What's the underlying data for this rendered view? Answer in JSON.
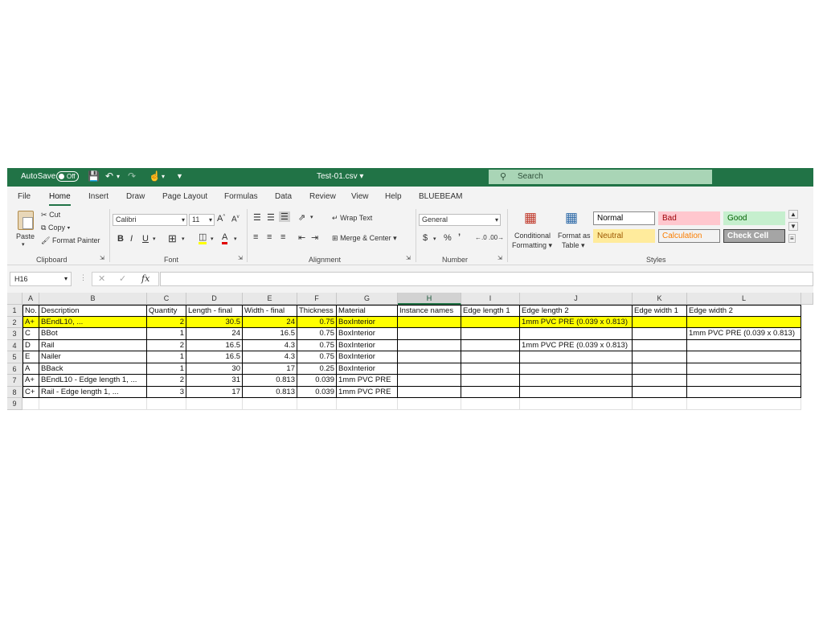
{
  "titlebar": {
    "autosave_label": "AutoSave",
    "autosave_state": "Off",
    "file_title": "Test-01.csv",
    "search_placeholder": "Search",
    "bg_color": "#217346"
  },
  "menu": [
    "File",
    "Home",
    "Insert",
    "Draw",
    "Page Layout",
    "Formulas",
    "Data",
    "Review",
    "View",
    "Help",
    "BLUEBEAM"
  ],
  "ribbon": {
    "clipboard": {
      "paste": "Paste",
      "cut": "Cut",
      "copy": "Copy",
      "format_painter": "Format Painter",
      "label": "Clipboard"
    },
    "font": {
      "name": "Calibri",
      "size": "11",
      "label": "Font"
    },
    "alignment": {
      "wrap": "Wrap Text",
      "merge": "Merge & Center",
      "label": "Alignment"
    },
    "number": {
      "format": "General",
      "label": "Number"
    },
    "styles_group": {
      "conditional": [
        "Conditional",
        "Formatting"
      ],
      "format_table": [
        "Format as",
        "Table"
      ],
      "label": "Styles"
    },
    "styles": [
      {
        "label": "Normal",
        "bg": "#ffffff",
        "color": "#000000",
        "border": "#8a8a8a"
      },
      {
        "label": "Bad",
        "bg": "#ffc7ce",
        "color": "#9c0006",
        "border": "#ffc7ce"
      },
      {
        "label": "Good",
        "bg": "#c6efce",
        "color": "#006100",
        "border": "#c6efce"
      },
      {
        "label": "Neutral",
        "bg": "#ffeb9c",
        "color": "#9c5700",
        "border": "#ffeb9c"
      },
      {
        "label": "Calculation",
        "bg": "#f2f2f2",
        "color": "#fa7d00",
        "border": "#7f7f7f"
      },
      {
        "label": "Check Cell",
        "bg": "#a5a5a5",
        "color": "#ffffff",
        "border": "#3f3f3f"
      }
    ]
  },
  "namebox": "H16",
  "sheet": {
    "columns": [
      "A",
      "B",
      "C",
      "D",
      "E",
      "F",
      "G",
      "H",
      "I",
      "J",
      "K",
      "L"
    ],
    "selected_column": "H",
    "row_numbers": [
      "1",
      "2",
      "3",
      "4",
      "5",
      "6",
      "7",
      "8",
      "9"
    ],
    "highlight_color": "#ffff00",
    "rows": [
      [
        "No.",
        "Description",
        "Quantity",
        "Length - final",
        "Width - final",
        "Thickness",
        "Material",
        "Instance names",
        "Edge length 1",
        "Edge length 2",
        "Edge width 1",
        "Edge width 2"
      ],
      [
        "A+",
        "BEndL10, ...",
        "2",
        "30.5",
        "24",
        "0.75",
        "BoxInterior",
        "",
        "",
        "1mm PVC PRE (0.039 x 0.813)",
        "",
        ""
      ],
      [
        "C",
        "BBot",
        "1",
        "24",
        "16.5",
        "0.75",
        "BoxInterior",
        "",
        "",
        "",
        "",
        "1mm PVC PRE (0.039 x 0.813)"
      ],
      [
        "D",
        "Rail",
        "2",
        "16.5",
        "4.3",
        "0.75",
        "BoxInterior",
        "",
        "",
        "1mm PVC PRE (0.039 x 0.813)",
        "",
        ""
      ],
      [
        "E",
        "Nailer",
        "1",
        "16.5",
        "4.3",
        "0.75",
        "BoxInterior",
        "",
        "",
        "",
        "",
        ""
      ],
      [
        "A",
        "BBack",
        "1",
        "30",
        "17",
        "0.25",
        "BoxInterior",
        "",
        "",
        "",
        "",
        ""
      ],
      [
        "A+",
        "BEndL10 - Edge length 1, ...",
        "2",
        "31",
        "0.813",
        "0.039",
        "1mm PVC PRE",
        "",
        "",
        "",
        "",
        ""
      ],
      [
        "C+",
        "Rail - Edge length 1, ...",
        "3",
        "17",
        "0.813",
        "0.039",
        "1mm PVC PRE",
        "",
        "",
        "",
        "",
        ""
      ]
    ]
  }
}
